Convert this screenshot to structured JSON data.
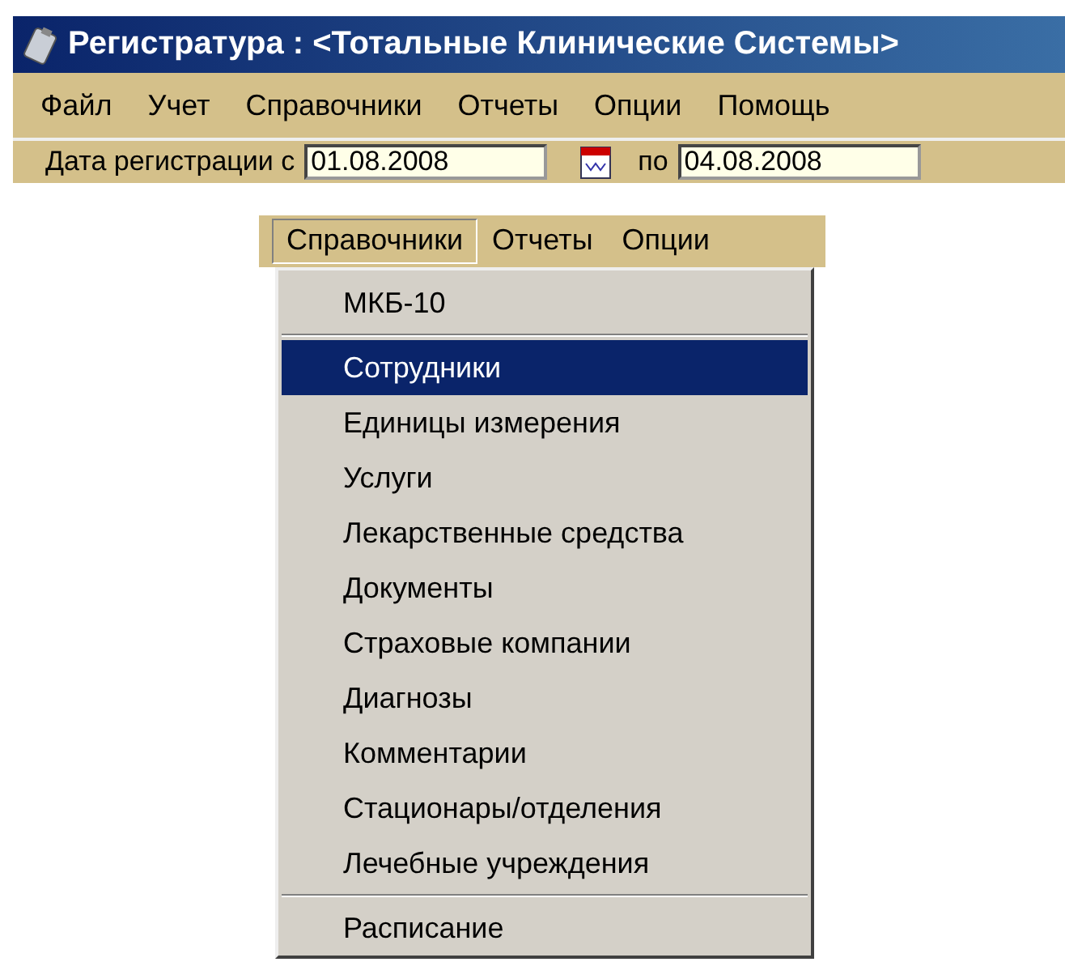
{
  "window": {
    "title": "Регистратура : <Тотальные Клинические Системы>"
  },
  "menu_bar": [
    {
      "label": "Файл",
      "selected": false
    },
    {
      "label": "Учет",
      "selected": false
    },
    {
      "label": "Справочники",
      "selected": false
    },
    {
      "label": "Отчеты",
      "selected": false
    },
    {
      "label": "Опции",
      "selected": false
    },
    {
      "label": "Помощь",
      "selected": false
    }
  ],
  "date_filter": {
    "label": "Дата регистрации с",
    "from": "01.08.2008",
    "to_label": "по",
    "to": "04.08.2008"
  },
  "zoomed_menu_bar": [
    {
      "label": "Справочники",
      "selected": true
    },
    {
      "label": "Отчеты",
      "selected": false
    },
    {
      "label": "Опции",
      "selected": false
    }
  ],
  "dropdown": {
    "items": [
      {
        "kind": "item",
        "label": "МКБ-10",
        "selected": false
      },
      {
        "kind": "separator"
      },
      {
        "kind": "item",
        "label": "Сотрудники",
        "selected": true
      },
      {
        "kind": "item",
        "label": "Единицы измерения",
        "selected": false
      },
      {
        "kind": "item",
        "label": "Услуги",
        "selected": false
      },
      {
        "kind": "item",
        "label": "Лекарственные средства",
        "selected": false
      },
      {
        "kind": "item",
        "label": "Документы",
        "selected": false
      },
      {
        "kind": "item",
        "label": "Страховые компании",
        "selected": false
      },
      {
        "kind": "item",
        "label": "Диагнозы",
        "selected": false
      },
      {
        "kind": "item",
        "label": "Комментарии",
        "selected": false
      },
      {
        "kind": "item",
        "label": "Стационары/отделения",
        "selected": false
      },
      {
        "kind": "item",
        "label": "Лечебные учреждения",
        "selected": false
      },
      {
        "kind": "separator"
      },
      {
        "kind": "item",
        "label": "Расписание",
        "selected": false
      }
    ]
  }
}
